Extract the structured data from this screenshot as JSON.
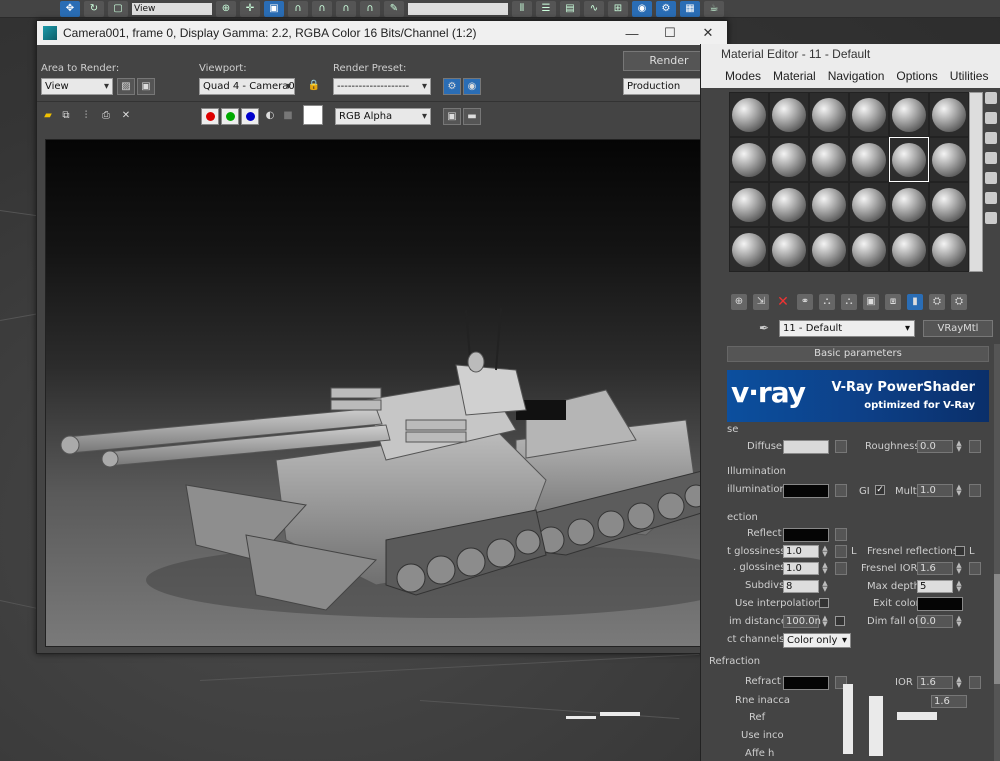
{
  "top_toolbar": {
    "view_field": "View"
  },
  "render_window": {
    "title": "Camera001, frame 0, Display Gamma: 2.2, RGBA Color 16 Bits/Channel (1:2)",
    "minimize": "—",
    "maximize": "☐",
    "close": "✕",
    "area_to_render_label": "Area to Render:",
    "area_to_render_value": "View",
    "viewport_label": "Viewport:",
    "viewport_value": "Quad 4 - Camera0",
    "render_preset_label": "Render Preset:",
    "render_preset_value": "--------------------",
    "render_button": "Render",
    "mode_value": "Production",
    "channel_value": "RGB Alpha"
  },
  "material_editor": {
    "title": "Material Editor - 11 - Default",
    "menu": [
      "Modes",
      "Material",
      "Navigation",
      "Options",
      "Utilities"
    ],
    "slot_count": 24,
    "active_slot": 10,
    "material_name": "11 - Default",
    "material_type": "VRayMtl",
    "rollout_title": "Basic parameters",
    "vray_logo": "v·ray",
    "vray_title": "V-Ray PowerShader",
    "vray_subtitle": "optimized for V-Ray",
    "diffuse_group": "se",
    "diffuse_label": "Diffuse",
    "roughness_label": "Roughness",
    "roughness_value": "0.0",
    "self_illum_group": "Illumination",
    "self_illum_label": "illumination",
    "gi_label": "GI",
    "gi_check": "✓",
    "mult_label": "Mult",
    "mult_value": "1.0",
    "reflection_group": "ection",
    "reflect_label": "Reflect",
    "glossiness_label": "t glossiness",
    "glossiness_value": "1.0",
    "hglossiness_label": ". glossiness",
    "hglossiness_value": "1.0",
    "fresnel_label": "Fresnel reflections",
    "fresnel_l": "L",
    "fresnel_ior_label": "Fresnel IOR",
    "fresnel_ior_value": "1.6",
    "subdivs_label": "Subdivs",
    "subdivs_value": "8",
    "max_depth_label": "Max depth",
    "max_depth_value": "5",
    "use_interp_label": "Use interpolation",
    "exit_color_label": "Exit color",
    "dim_distance_label": "im distance",
    "dim_distance_value": "100.0n",
    "dim_falloff_label": "Dim fall off",
    "dim_falloff_value": "0.0",
    "affect_channels_label": "ct channels",
    "affect_channels_value": "Color only",
    "refraction_group": "Refraction",
    "refract_label": "Refract",
    "ior_label": "IOR",
    "ior_value": "1.6",
    "glossiness_r_label": "Rne inacca",
    "glossiness_r_value": "1.6",
    "ref_label": "Ref",
    "use_interp2_label": "Use inco",
    "affect_label": "Affe h"
  },
  "colors": {
    "vray_blue": "#0c4f9e",
    "diffuse_color": "#d9d9d9",
    "reflect_color": "#050505",
    "exit_color": "#050505",
    "accent_blue": "#2a6db5"
  }
}
